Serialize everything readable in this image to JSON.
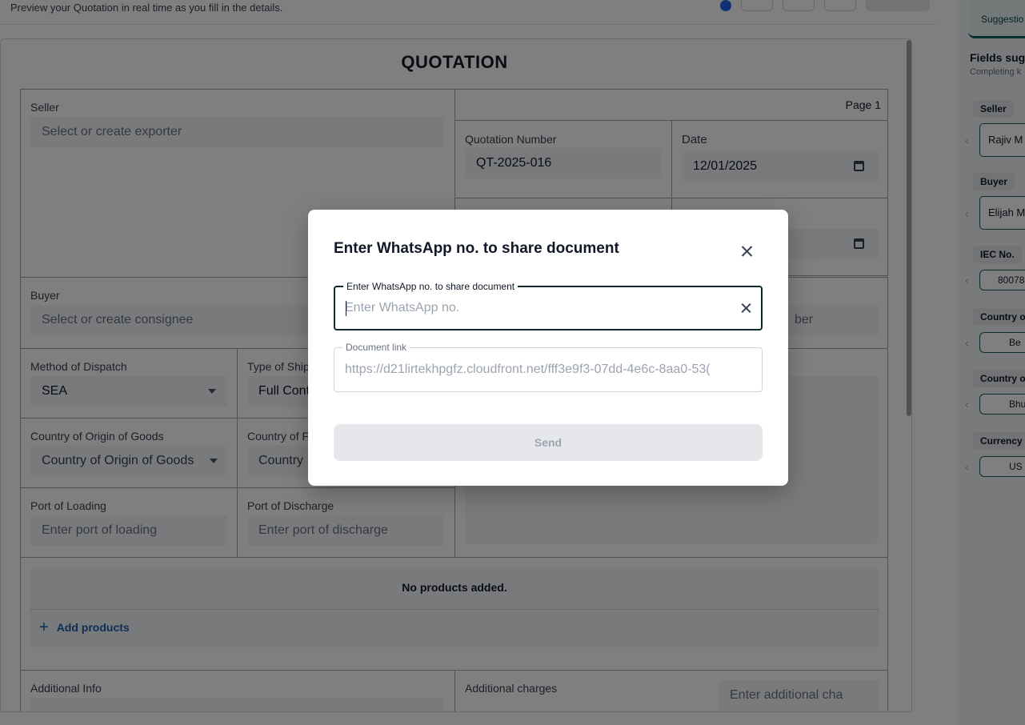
{
  "header": {
    "subtitle": "Preview your Quotation in real time as you fill in the details."
  },
  "document": {
    "title": "QUOTATION",
    "page_label": "Page 1",
    "seller": {
      "label": "Seller",
      "placeholder": "Select or create exporter"
    },
    "buyer": {
      "label": "Buyer",
      "placeholder": "Select or create consignee"
    },
    "quotation_number": {
      "label": "Quotation Number",
      "value": "QT-2025-016"
    },
    "date": {
      "label": "Date",
      "value": "12/01/2025"
    },
    "partial_right_placeholder": "ber",
    "method_of_dispatch": {
      "label": "Method of Dispatch",
      "value": "SEA"
    },
    "type_of_shipment": {
      "label": "Type of Ship",
      "value": "Full Cont"
    },
    "country_origin": {
      "label": "Country of Origin of Goods",
      "placeholder": "Country of Origin of Goods"
    },
    "country_dest": {
      "label": "Country of F",
      "placeholder": "Country"
    },
    "port_loading": {
      "label": "Port of Loading",
      "placeholder": "Enter port of loading"
    },
    "port_discharge": {
      "label": "Port of Discharge",
      "placeholder": "Enter port of discharge"
    },
    "products": {
      "empty_text": "No products added.",
      "add_label": "Add products"
    },
    "additional_info": {
      "label": "Additional Info"
    },
    "additional_charges": {
      "label": "Additional charges",
      "placeholder": "Enter additional cha"
    }
  },
  "sidebar": {
    "tab_label": "Suggestio",
    "title": "Fields sug",
    "subtitle": "Completing k",
    "items": [
      {
        "label": "Seller",
        "value": "Rajiv M"
      },
      {
        "label": "Buyer",
        "value": "Elijah M"
      },
      {
        "label": "IEC No.",
        "value": "80078"
      },
      {
        "label": "Country o",
        "value": "Be"
      },
      {
        "label": "Country o",
        "value": "Bhu"
      },
      {
        "label": "Currency",
        "value": "US"
      }
    ]
  },
  "modal": {
    "title": "Enter WhatsApp no. to share document",
    "whatsapp_field": {
      "legend": "Enter WhatsApp no. to share document",
      "placeholder": "Enter WhatsApp no."
    },
    "document_link": {
      "legend": "Document link",
      "value": "https://d21lirtekhpgfz.cloudfront.net/fff3e9f3-07dd-4e6c-8aa0-53("
    },
    "send_label": "Send"
  },
  "colors": {
    "overlay": "#000000",
    "accent_teal": "#0f5f5f",
    "link_blue": "#1e5fae",
    "disabled_button": "#e5e7eb"
  }
}
